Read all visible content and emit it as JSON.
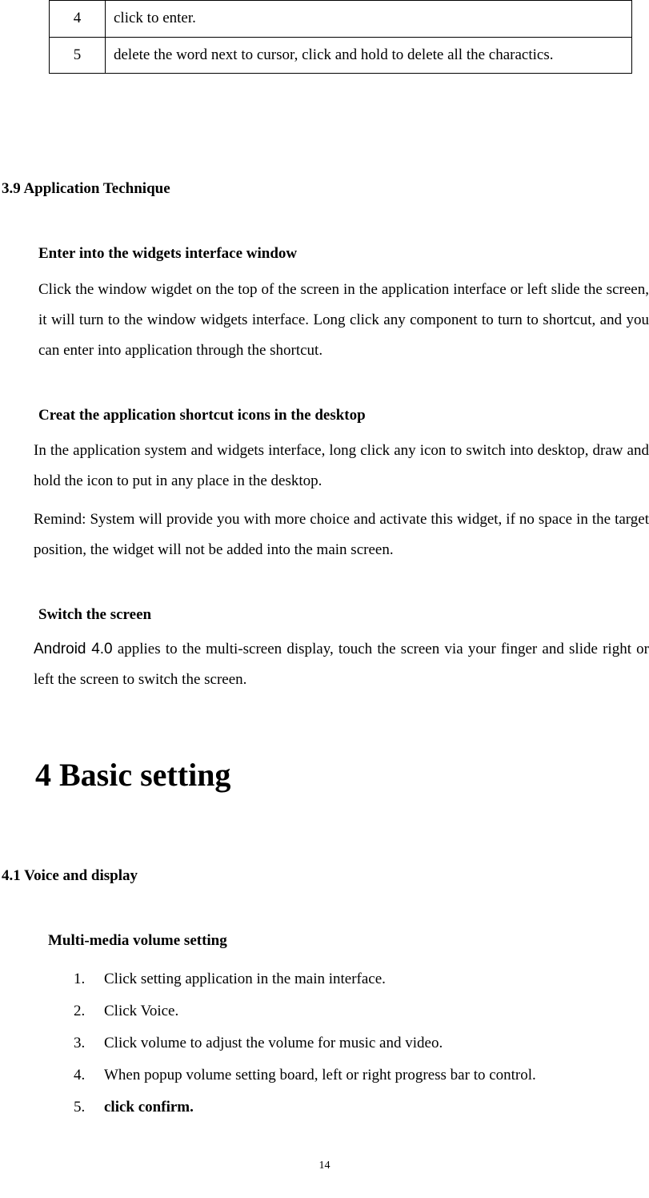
{
  "table": {
    "rows": [
      {
        "num": "4",
        "desc": "click to enter."
      },
      {
        "num": "5",
        "desc": "delete the word next to cursor, click and hold to delete all the charactics."
      }
    ]
  },
  "section39": {
    "heading": "3.9 Application Technique",
    "sub1": {
      "heading": "Enter into the widgets interface window",
      "para": "Click the window wigdet on the top of the screen in the application interface or left slide the screen, it will turn to the window widgets interface. Long click any component to turn to shortcut, and you can enter into application through the shortcut."
    },
    "sub2": {
      "heading": "Creat the application shortcut icons in the desktop",
      "para1": "In the application system and widgets interface, long click any icon to switch into desktop, draw and hold the icon to put in any place in the desktop.",
      "para2": "Remind: System will provide you with more choice and activate this widget, if no space in the target position, the widget will not be added into the main screen."
    },
    "sub3": {
      "heading": "Switch the screen",
      "android": "Android 4.0",
      "para": " applies to the multi-screen display, touch the screen via your finger and slide right or left the screen to switch the screen."
    }
  },
  "chapter4": {
    "title": "4 Basic setting",
    "section41": {
      "heading": "4.1 Voice and display",
      "subheading": "Multi-media volume setting",
      "steps": [
        {
          "num": "1.",
          "text": "Click setting application in the main interface."
        },
        {
          "num": "2.",
          "text": "Click Voice."
        },
        {
          "num": "3.",
          "text": "Click volume to adjust the volume for music and video."
        },
        {
          "num": "4.",
          "text": "When popup volume setting board, left or right progress bar to control."
        },
        {
          "num": "5.",
          "text": "click confirm."
        }
      ]
    }
  },
  "pageNumber": "14"
}
